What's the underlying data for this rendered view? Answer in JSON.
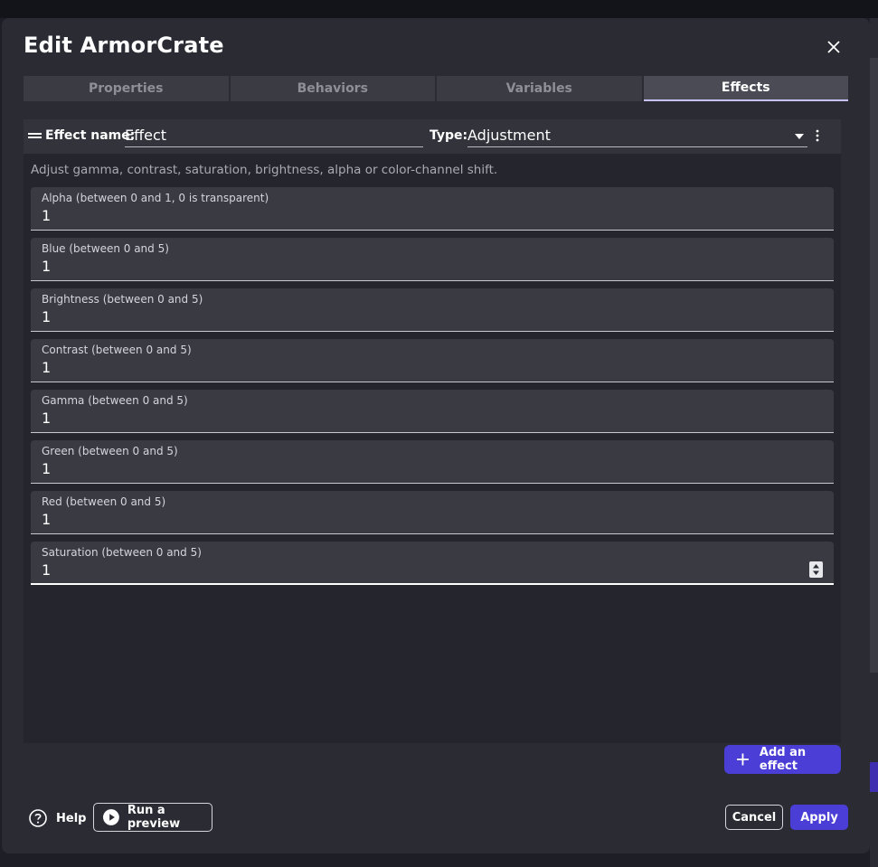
{
  "dialog": {
    "title": "Edit ArmorCrate",
    "close_icon": "close-icon"
  },
  "tabs": [
    {
      "label": "Properties",
      "active": false
    },
    {
      "label": "Behaviors",
      "active": false
    },
    {
      "label": "Variables",
      "active": false
    },
    {
      "label": "Effects",
      "active": true
    }
  ],
  "effect": {
    "name_label": "Effect name:",
    "name_value": "Effect",
    "type_label": "Type:",
    "type_value": "Adjustment",
    "description": "Adjust gamma, contrast, saturation, brightness, alpha or color-channel shift."
  },
  "params": [
    {
      "label": "Alpha (between 0 and 1, 0 is transparent)",
      "value": "1"
    },
    {
      "label": "Blue (between 0 and 5)",
      "value": "1"
    },
    {
      "label": "Brightness (between 0 and 5)",
      "value": "1"
    },
    {
      "label": "Contrast (between 0 and 5)",
      "value": "1"
    },
    {
      "label": "Gamma (between 0 and 5)",
      "value": "1"
    },
    {
      "label": "Green (between 0 and 5)",
      "value": "1"
    },
    {
      "label": "Red (between 0 and 5)",
      "value": "1"
    },
    {
      "label": "Saturation (between 0 and 5)",
      "value": "1"
    }
  ],
  "actions": {
    "add_effect": "Add an effect",
    "help": "Help",
    "run_preview": "Run a preview",
    "cancel": "Cancel",
    "apply": "Apply"
  },
  "colors": {
    "accent": "#4a3ed6",
    "dialog_bg": "#2a2b33",
    "field_bg": "#393a42"
  }
}
